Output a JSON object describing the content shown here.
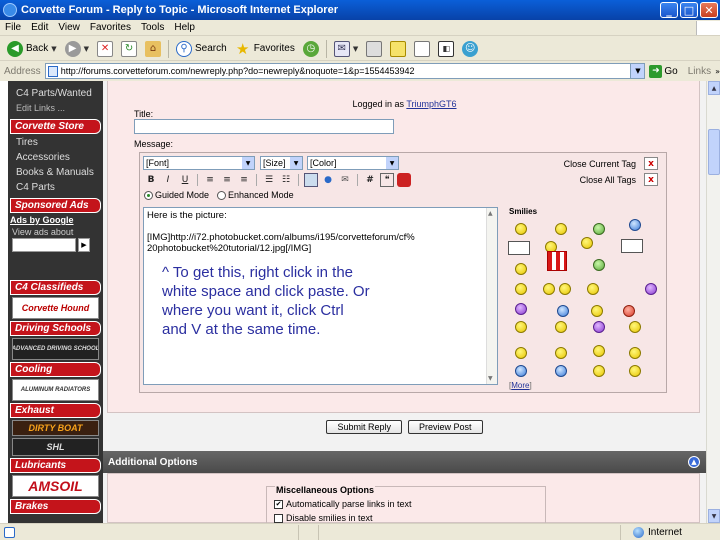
{
  "window": {
    "title": "Corvette Forum - Reply to Topic - Microsoft Internet Explorer",
    "buttons": {
      "minimize": "_",
      "maximize": "□",
      "close": "✕"
    }
  },
  "menu": [
    "File",
    "Edit",
    "View",
    "Favorites",
    "Tools",
    "Help"
  ],
  "toolbar": {
    "back": "Back",
    "search": "Search",
    "favorites": "Favorites"
  },
  "address": {
    "label": "Address",
    "url": "http://forums.corvetteforum.com/newreply.php?do=newreply&noquote=1&p=1554453942",
    "go": "Go",
    "links": "Links"
  },
  "sidebar": {
    "top_items": [
      "C4 Parts/Wanted"
    ],
    "edit_links": "Edit Links ...",
    "corvette_store": {
      "header": "Corvette Store",
      "items": [
        "Tires",
        "Accessories",
        "Books & Manuals",
        "C4 Parts"
      ]
    },
    "sponsored": {
      "header": "Sponsored Ads",
      "ads_by_google": "Ads by Google",
      "view_ads": "View ads about"
    },
    "classifieds": {
      "header": "C4 Classifieds",
      "banner": "Corvette Hound"
    },
    "driving": {
      "header": "Driving Schools",
      "banner": "ADVANCED DRIVING SCHOOL"
    },
    "cooling": {
      "header": "Cooling",
      "banner": "ALUMINUM RADIATORS"
    },
    "exhaust": {
      "header": "Exhaust",
      "banner1": "DIRTY BOAT",
      "banner2": "SHL"
    },
    "lubricants": {
      "header": "Lubricants",
      "banner": "AMSOIL"
    },
    "brakes": {
      "header": "Brakes"
    }
  },
  "form": {
    "logged_in_prefix": "Logged in as ",
    "username": "TriumphGT6",
    "title_label": "Title:",
    "message_label": "Message:",
    "font_select": "[Font]",
    "size_select": "[Size]",
    "color_select": "[Color]",
    "close_current_tag": "Close Current Tag",
    "close_all_tags": "Close All Tags",
    "close_x": "x",
    "format_buttons": {
      "bold": "B",
      "italic": "I",
      "underline": "U",
      "hash": "#"
    },
    "guided_mode": "Guided Mode",
    "enhanced_mode": "Enhanced Mode",
    "message_lines": [
      "Here is the picture:",
      "",
      "[IMG]http://i72.photobucket.com/albums/i195/corvetteforum/cf%",
      "20photobucket%20tutorial/12.jpg[/IMG]"
    ],
    "annotation": "^ To get this, right click in the white space and click paste.  Or where you want it, click Ctrl and V at the same time.",
    "smilies_label": "Smilies",
    "more_label": "More",
    "submit": "Submit Reply",
    "preview": "Preview Post"
  },
  "additional_options": {
    "header": "Additional Options",
    "misc_label": "Miscellaneous Options",
    "parse_links": "Automatically parse links in text",
    "parse_links_checked": true,
    "disable_smilies": "Disable smilies in text",
    "disable_smilies_checked": false
  },
  "status": {
    "zone": "Internet"
  },
  "colors": {
    "titlebar": "#0a5fd8",
    "sidebar_header": "#c4141b",
    "form_bg": "#fbe9e9",
    "annotation": "#2b2fa0"
  }
}
